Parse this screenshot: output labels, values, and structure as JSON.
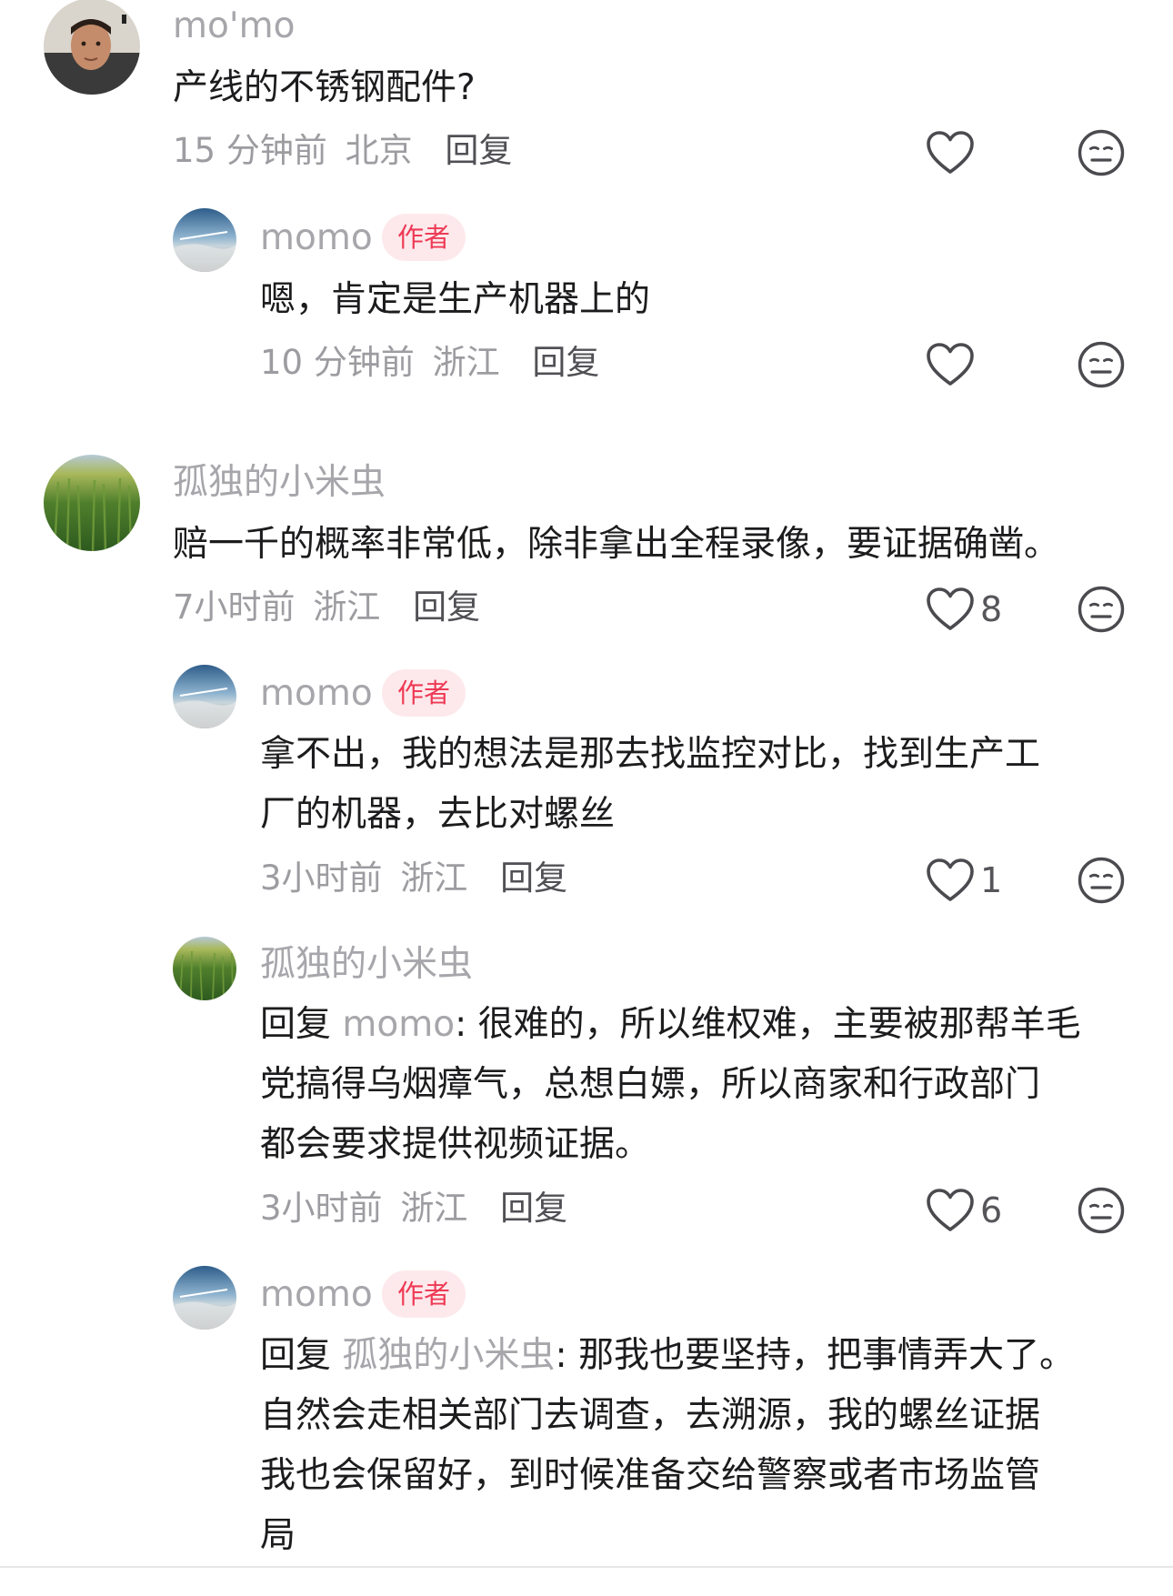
{
  "comments": [
    {
      "username": "mo'mo",
      "text": "产线的不锈钢配件?",
      "time": "15 分钟前",
      "location": "北京",
      "reply_label": "回复"
    },
    {
      "username": "momo",
      "badge": "作者",
      "text": "嗯，肯定是生产机器上的",
      "time": "10 分钟前",
      "location": "浙江",
      "reply_label": "回复"
    },
    {
      "username": "孤独的小米虫",
      "text": "赔一千的概率非常低，除非拿出全程录像，要证据确凿。",
      "time": "7小时前",
      "location": "浙江",
      "reply_label": "回复",
      "likes": "8"
    },
    {
      "username": "momo",
      "badge": "作者",
      "lines": [
        "拿不出，我的想法是那去找监控对比，找到生产工",
        "厂的机器，去比对螺丝"
      ],
      "time": "3小时前",
      "location": "浙江",
      "reply_label": "回复",
      "likes": "1"
    },
    {
      "username": "孤独的小米虫",
      "reply_prefix": "回复",
      "mention": "momo",
      "lines": [
        ": 很难的，所以维权难，主要被那帮羊毛",
        "党搞得乌烟瘴气，总想白嫖，所以商家和行政部门",
        "都会要求提供视频证据。"
      ],
      "time": "3小时前",
      "location": "浙江",
      "reply_label": "回复",
      "likes": "6"
    },
    {
      "username": "momo",
      "badge": "作者",
      "reply_prefix": "回复",
      "mention": "孤独的小米虫",
      "lines": [
        ": 那我也要坚持，把事情弄大了。",
        "自然会走相关部门去调查，去溯源，我的螺丝证据",
        "我也会保留好，到时候准备交给警察或者市场监管",
        "局"
      ]
    }
  ],
  "icons": {
    "like": "heart-outline-icon",
    "dislike": "neutral-face-icon"
  },
  "colors": {
    "badge_text": "#ee3a55",
    "badge_bg": "#fde9ec",
    "username": "#a6a6ab",
    "body_text": "#1c1c1e"
  }
}
